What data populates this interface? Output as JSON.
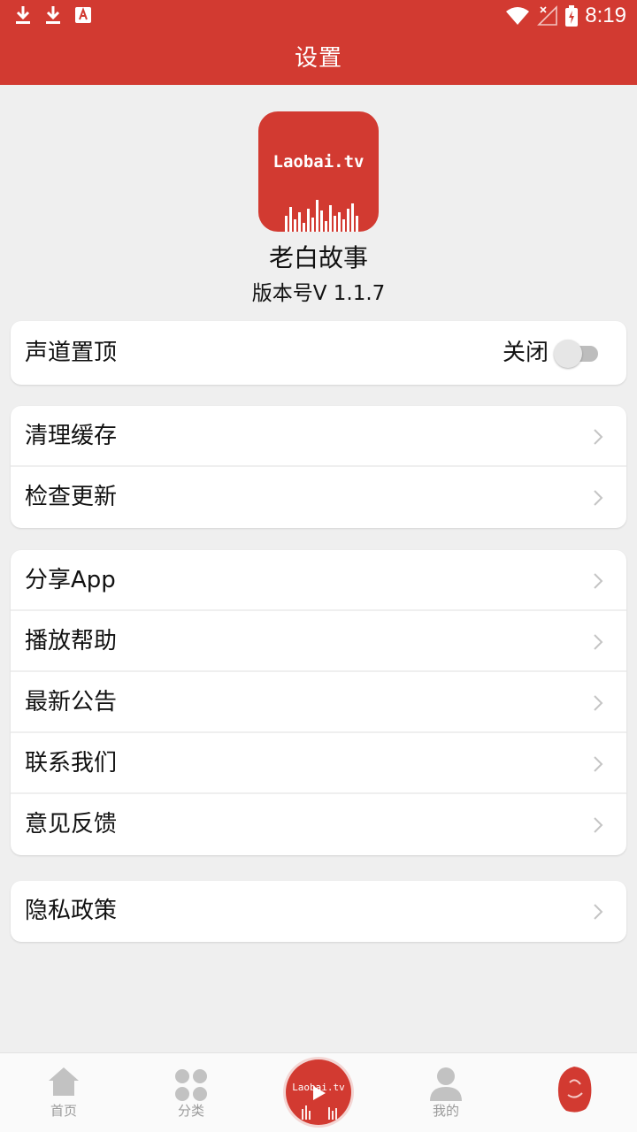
{
  "status_bar": {
    "time": "8:19"
  },
  "app_bar": {
    "title": "设置"
  },
  "header": {
    "logo_text": "Laobai.tv",
    "app_name": "老白故事",
    "version": "版本号V 1.1.7"
  },
  "groups": {
    "channel_top": {
      "label": "声道置顶",
      "toggle_text": "关闭",
      "toggle_on": false
    },
    "group2": [
      {
        "label": "清理缓存"
      },
      {
        "label": "检查更新"
      }
    ],
    "group3": [
      {
        "label": "分享App"
      },
      {
        "label": "播放帮助"
      },
      {
        "label": "最新公告"
      },
      {
        "label": "联系我们"
      },
      {
        "label": "意见反馈"
      }
    ],
    "group4": [
      {
        "label": "隐私政策"
      }
    ]
  },
  "bottom_nav": {
    "home": "首页",
    "category": "分类",
    "center_text": "Laobai.tv",
    "mine": "我的"
  },
  "colors": {
    "brand": "#d23a31",
    "background": "#efefef",
    "nav_inactive": "#9a9a9a"
  }
}
